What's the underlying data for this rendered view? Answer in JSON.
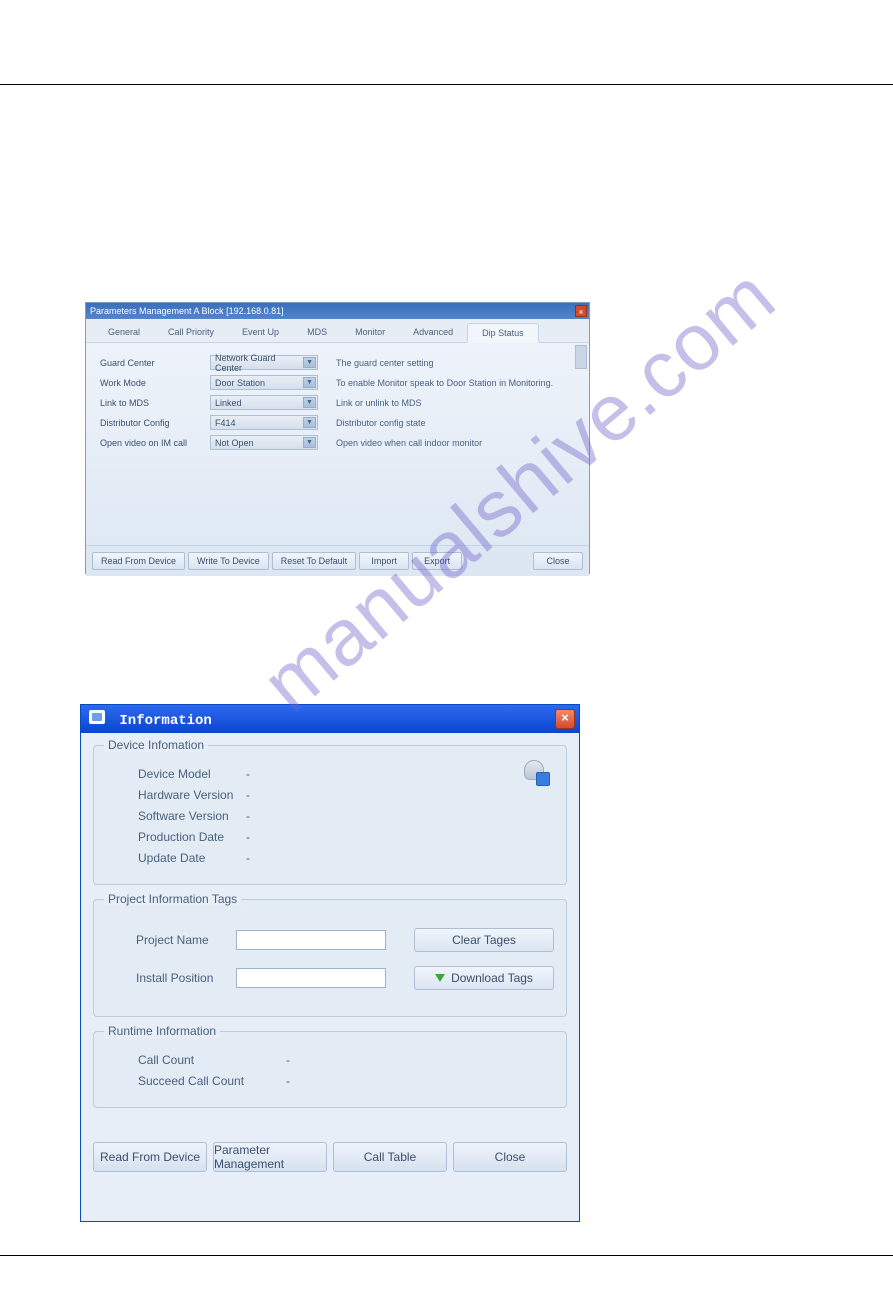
{
  "watermark": "manualshive.com",
  "win1": {
    "title": "Parameters Management A Block [192.168.0.81]",
    "tabs": [
      "General",
      "Call Priority",
      "Event Up",
      "MDS",
      "Monitor",
      "Advanced",
      "Dip Status"
    ],
    "activeTab": 6,
    "rows": [
      {
        "label": "Guard Center",
        "value": "Network Guard Center",
        "desc": "The guard center setting"
      },
      {
        "label": "Work Mode",
        "value": "Door Station",
        "desc": "To enable Monitor speak to Door Station in Monitoring."
      },
      {
        "label": "Link to MDS",
        "value": "Linked",
        "desc": "Link or unlink to MDS"
      },
      {
        "label": "Distributor Config",
        "value": "F414",
        "desc": "Distributor config state"
      },
      {
        "label": "Open video on IM call",
        "value": "Not Open",
        "desc": "Open video when call indoor monitor"
      }
    ],
    "footer": [
      "Read From Device",
      "Write To Device",
      "Reset To Default",
      "Import",
      "Export"
    ],
    "closeBtn": "Close"
  },
  "win2": {
    "title": "Information",
    "deviceInfo": {
      "legend": "Device Infomation",
      "rows": [
        {
          "label": "Device Model",
          "value": "-"
        },
        {
          "label": "Hardware Version",
          "value": "-"
        },
        {
          "label": "Software Version",
          "value": "-"
        },
        {
          "label": "Production Date",
          "value": "-"
        },
        {
          "label": "Update Date",
          "value": "-"
        }
      ]
    },
    "projectTags": {
      "legend": "Project Information Tags",
      "projectNameLabel": "Project Name",
      "installPositionLabel": "Install Position",
      "clearBtn": "Clear Tages",
      "downloadBtn": "Download Tags"
    },
    "runtime": {
      "legend": "Runtime Information",
      "rows": [
        {
          "label": "Call Count",
          "value": "-"
        },
        {
          "label": "Succeed Call Count",
          "value": "-"
        }
      ]
    },
    "footer": [
      "Read From Device",
      "Parameter Management",
      "Call Table",
      "Close"
    ]
  }
}
